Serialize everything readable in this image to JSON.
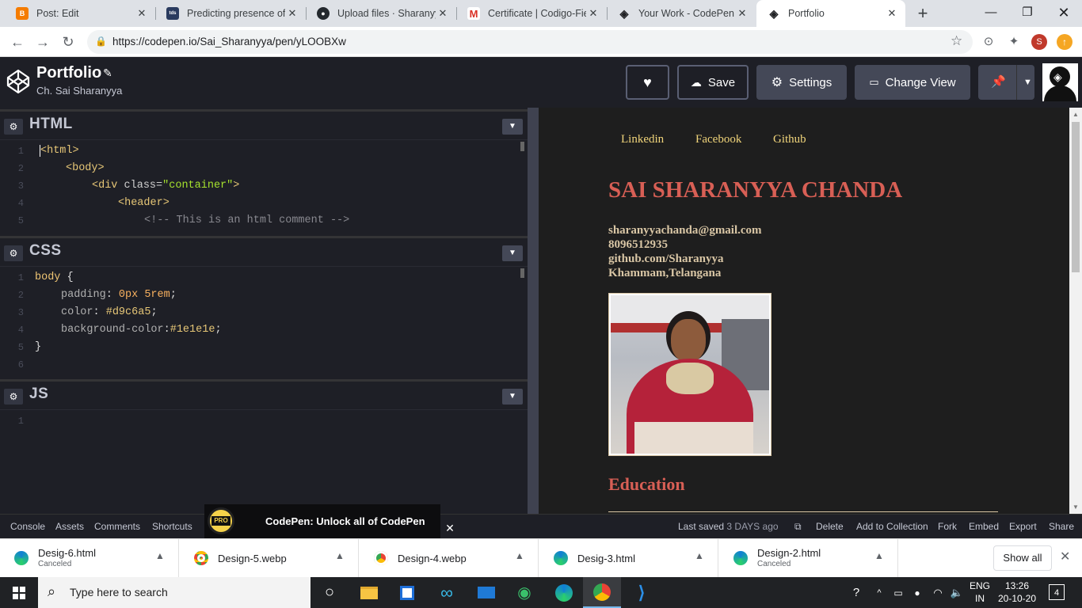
{
  "browser": {
    "tabs": [
      {
        "title": "Post: Edit",
        "icon": "blogger-icon",
        "color": "#f57c00",
        "glyph": "B"
      },
      {
        "title": "Predicting presence of H",
        "icon": "tds-icon",
        "color": "#2a3b5f",
        "glyph": "tds"
      },
      {
        "title": "Upload files · Sharanyya",
        "icon": "github-icon",
        "color": "#24292e",
        "glyph": "●"
      },
      {
        "title": "Certificate | Codigo-Fie",
        "icon": "gmail-icon",
        "color": "#ffffff",
        "glyph": "M"
      },
      {
        "title": "Your Work - CodePen",
        "icon": "codepen-icon",
        "color": "#1e1f26",
        "glyph": "◈"
      },
      {
        "title": "Portfolio",
        "icon": "codepen-icon",
        "color": "#1e1f26",
        "glyph": "◈"
      }
    ],
    "new_tab": "+",
    "url": "https://codepen.io/Sai_Sharanyya/pen/yLOOBXw",
    "profile_initial": "S"
  },
  "codepen": {
    "title": "Portfolio",
    "author": "Ch. Sai Sharanyya",
    "buttons": {
      "save": "Save",
      "settings": "Settings",
      "change_view": "Change View"
    },
    "panels": {
      "html": "HTML",
      "css": "CSS",
      "js": "JS"
    },
    "html_lines": [
      "1",
      "2",
      "3",
      "4",
      "5"
    ],
    "css_lines": [
      "1",
      "2",
      "3",
      "4",
      "5",
      "6"
    ],
    "js_lines": [
      "1"
    ],
    "footer": {
      "console": "Console",
      "assets": "Assets",
      "comments": "Comments",
      "shortcuts": "Shortcuts",
      "promo": "CodePen: Unlock all of CodePen",
      "promo_badge": "PRO",
      "last_saved": "Last saved",
      "saved_when": "3 DAYS ago",
      "delete": "Delete",
      "add_collection": "Add to Collection",
      "fork": "Fork",
      "embed": "Embed",
      "export": "Export",
      "share": "Share"
    }
  },
  "code": {
    "h1": "<html>",
    "h2": "<body>",
    "h3a": "<div ",
    "h3b": "class",
    "h3c": "=",
    "h3d": "\"container\"",
    "h3e": ">",
    "h4": "<header>",
    "h5": "<!-- This is an html comment -->",
    "c1a": "body ",
    "c1b": "{",
    "c2a": "padding",
    ": ": ": ",
    "c2b": "0px 5rem",
    "c2c": ";",
    "c3a": "color",
    "c3b": "#d9c6a5",
    "c3c": ";",
    "c4a": "background-color",
    "c4b": "#1e1e1e",
    "c4c": ";",
    "c5": "}"
  },
  "preview": {
    "nav": [
      "Linkedin",
      "Facebook",
      "Github"
    ],
    "name": "SAI SHARANYYA CHANDA",
    "contact": [
      "sharanyyachanda@gmail.com",
      "8096512935",
      "github.com/Sharanyya",
      "Khammam,Telangana"
    ],
    "section": "Education"
  },
  "downloads": [
    {
      "name": "Desig-6.html",
      "status": "Canceled",
      "icon": "edge-icon"
    },
    {
      "name": "Design-5.webp",
      "status": "",
      "icon": "chrome-icon"
    },
    {
      "name": "Design-4.webp",
      "status": "",
      "icon": "chrome-icon"
    },
    {
      "name": "Desig-3.html",
      "status": "",
      "icon": "edge-icon"
    },
    {
      "name": "Design-2.html",
      "status": "Canceled",
      "icon": "edge-icon"
    }
  ],
  "download_show_all": "Show all",
  "taskbar": {
    "search_placeholder": "Type here to search",
    "lang": "ENG",
    "region": "IN",
    "time": "13:26",
    "date": "20-10-20",
    "notifications": "4"
  },
  "colors": {
    "accent_red": "#d9534f",
    "heading": "#d85f55",
    "body_text": "#d9c6a5"
  }
}
